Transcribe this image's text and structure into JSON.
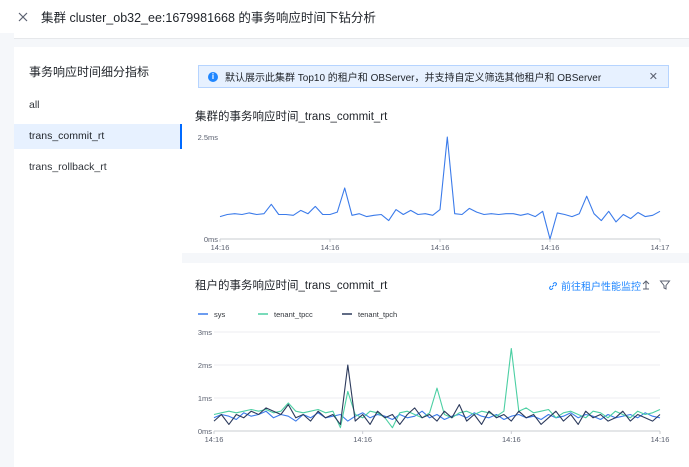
{
  "header": {
    "title": "集群 cluster_ob32_ee:1679981668 的事务响应时间下钻分析"
  },
  "sidebar": {
    "title": "事务响应时间细分指标",
    "items": [
      {
        "label": "all",
        "active": false
      },
      {
        "label": "trans_commit_rt",
        "active": true
      },
      {
        "label": "trans_rollback_rt",
        "active": false
      }
    ]
  },
  "alert": {
    "text": "默认展示此集群 Top10 的租户和 OBServer，并支持自定义筛选其他租户和 OBServer"
  },
  "cluster_chart": {
    "title": "集群的事务响应时间_trans_commit_rt"
  },
  "tenant_chart": {
    "title": "租户的事务响应时间_trans_commit_rt",
    "link_label": "前往租户性能监控"
  },
  "colors": {
    "accent": "#1f86ff",
    "sys": "#3b7bea",
    "tenant_tpcc": "#4ccfa3",
    "tenant_tpch": "#2c3a5c"
  },
  "chart_data": [
    {
      "type": "line",
      "title": "集群的事务响应时间_trans_commit_rt",
      "x_ticks": [
        "14:16",
        "14:16",
        "14:16",
        "14:16",
        "14:17"
      ],
      "y_ticks": [
        "0ms",
        "2.5ms"
      ],
      "ylim": [
        0,
        2.5
      ],
      "grid": false,
      "series": [
        {
          "values": [
            0.55,
            0.6,
            0.62,
            0.6,
            0.64,
            0.6,
            0.62,
            0.85,
            0.6,
            0.6,
            0.58,
            0.7,
            0.62,
            0.8,
            0.6,
            0.6,
            0.66,
            1.25,
            0.58,
            0.62,
            0.55,
            0.58,
            0.6,
            0.45,
            0.72,
            0.6,
            0.7,
            0.6,
            0.62,
            0.58,
            0.72,
            2.5,
            0.62,
            0.6,
            0.75,
            0.66,
            0.6,
            0.62,
            0.6,
            0.62,
            0.62,
            0.58,
            0.62,
            0.55,
            0.68,
            0.0,
            0.64,
            0.6,
            0.55,
            0.62,
            1.05,
            0.62,
            0.45,
            0.68,
            0.42,
            0.6,
            0.5,
            0.65,
            0.55,
            0.58,
            0.68
          ]
        }
      ]
    },
    {
      "type": "line",
      "title": "租户的事务响应时间_trans_commit_rt",
      "x_ticks": [
        "14:16",
        "14:16",
        "14:16",
        "14:16"
      ],
      "y_ticks": [
        "0ms",
        "1ms",
        "2ms",
        "3ms"
      ],
      "ylim": [
        0,
        3
      ],
      "legend": "top-left",
      "grid": true,
      "series": [
        {
          "name": "sys",
          "values": [
            0.4,
            0.5,
            0.45,
            0.35,
            0.55,
            0.45,
            0.5,
            0.6,
            0.4,
            0.5,
            0.45,
            0.3,
            0.5,
            0.4,
            0.55,
            0.4,
            0.45,
            0.5,
            0.3,
            0.45,
            0.55,
            0.4,
            0.5,
            0.45,
            0.35,
            0.5,
            0.4,
            0.45,
            0.6,
            0.4,
            0.5,
            0.35,
            0.45,
            0.5,
            0.4,
            0.55,
            0.45,
            0.4,
            0.5,
            0.35,
            0.45,
            0.5,
            0.4,
            0.45,
            0.35,
            0.5,
            0.4,
            0.45,
            0.55,
            0.4,
            0.5,
            0.45,
            0.35,
            0.5,
            0.4,
            0.45,
            0.5,
            0.4,
            0.55,
            0.45,
            0.4
          ]
        },
        {
          "name": "tenant_tpcc",
          "values": [
            0.5,
            0.55,
            0.6,
            0.55,
            0.6,
            0.65,
            0.6,
            0.65,
            0.55,
            0.6,
            0.85,
            0.6,
            0.55,
            0.6,
            0.65,
            0.55,
            0.6,
            0.1,
            1.2,
            0.5,
            0.4,
            0.6,
            0.55,
            0.4,
            0.1,
            0.55,
            0.6,
            0.5,
            0.4,
            0.55,
            1.3,
            0.5,
            0.4,
            0.55,
            0.6,
            0.5,
            0.6,
            0.55,
            0.45,
            0.6,
            2.5,
            0.6,
            0.7,
            0.55,
            0.6,
            0.65,
            0.4,
            0.55,
            0.6,
            0.5,
            0.4,
            0.6,
            0.55,
            0.4,
            0.6,
            0.5,
            0.4,
            0.6,
            0.5,
            0.55,
            0.65
          ]
        },
        {
          "name": "tenant_tpch",
          "values": [
            0.3,
            0.5,
            0.2,
            0.5,
            0.4,
            0.6,
            0.5,
            0.7,
            0.6,
            0.5,
            0.8,
            0.4,
            0.5,
            0.3,
            0.6,
            0.4,
            0.5,
            0.2,
            2.0,
            0.3,
            0.5,
            0.2,
            0.6,
            0.4,
            0.5,
            0.2,
            0.5,
            0.7,
            0.4,
            0.5,
            0.3,
            0.6,
            0.4,
            0.8,
            0.3,
            0.5,
            0.2,
            0.6,
            0.4,
            0.5,
            0.3,
            0.6,
            0.4,
            0.5,
            0.2,
            0.4,
            0.6,
            0.3,
            0.5,
            0.2,
            0.6,
            0.4,
            0.5,
            0.3,
            0.4,
            0.6,
            0.3,
            0.5,
            0.4,
            0.3,
            0.5
          ]
        }
      ]
    }
  ]
}
